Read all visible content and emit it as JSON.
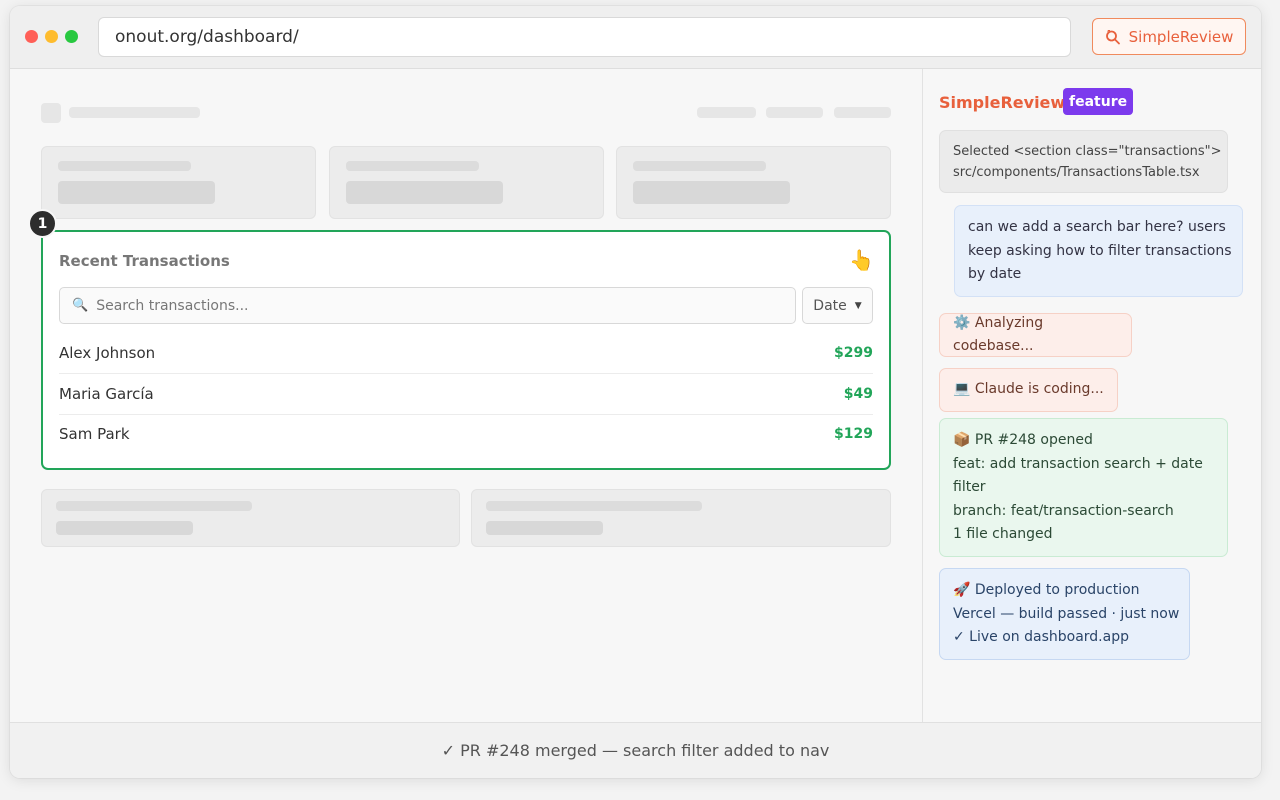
{
  "browser": {
    "url": "onout.org/dashboard/",
    "extension_label": "SimpleReview",
    "extension_icon": "magnifier-icon"
  },
  "transactions": {
    "marker_number": "1",
    "title": "Recent Transactions",
    "pointer_icon": "👆",
    "search_icon": "🔍",
    "search_placeholder": "Search transactions...",
    "date_filter": "Date",
    "date_caret": "▼",
    "rows": [
      {
        "name": "Alex Johnson",
        "amount": "$299"
      },
      {
        "name": "Maria García",
        "amount": "$49"
      },
      {
        "name": "Sam Park",
        "amount": "$129"
      }
    ]
  },
  "sidebar": {
    "title": "SimpleReview",
    "tag": "feature",
    "context_line1": "Selected <section class=\"transactions\">",
    "context_line2": "src/components/TransactionsTable.tsx",
    "user_line1": "can we add a search bar here? users",
    "user_line2": "keep asking how to filter transactions",
    "user_line3": "by date",
    "status_analyzing": "⚙️ Analyzing codebase...",
    "status_coding": "💻 Claude is coding...",
    "pr_line1": "📦 PR #248 opened",
    "pr_line2": "feat: add transaction search + date",
    "pr_line3": "filter",
    "pr_line4": "branch: feat/transaction-search",
    "pr_line5": "1 file changed",
    "deploy_line1": "🚀 Deployed to production",
    "deploy_line2": "Vercel — build passed · just now",
    "deploy_line3": "✓ Live on dashboard.app"
  },
  "footer": {
    "text": "✓ PR #248 merged — search filter added to nav"
  },
  "colors": {
    "accent": "#e8603c",
    "success": "#22a559",
    "tag": "#7c3aed"
  }
}
